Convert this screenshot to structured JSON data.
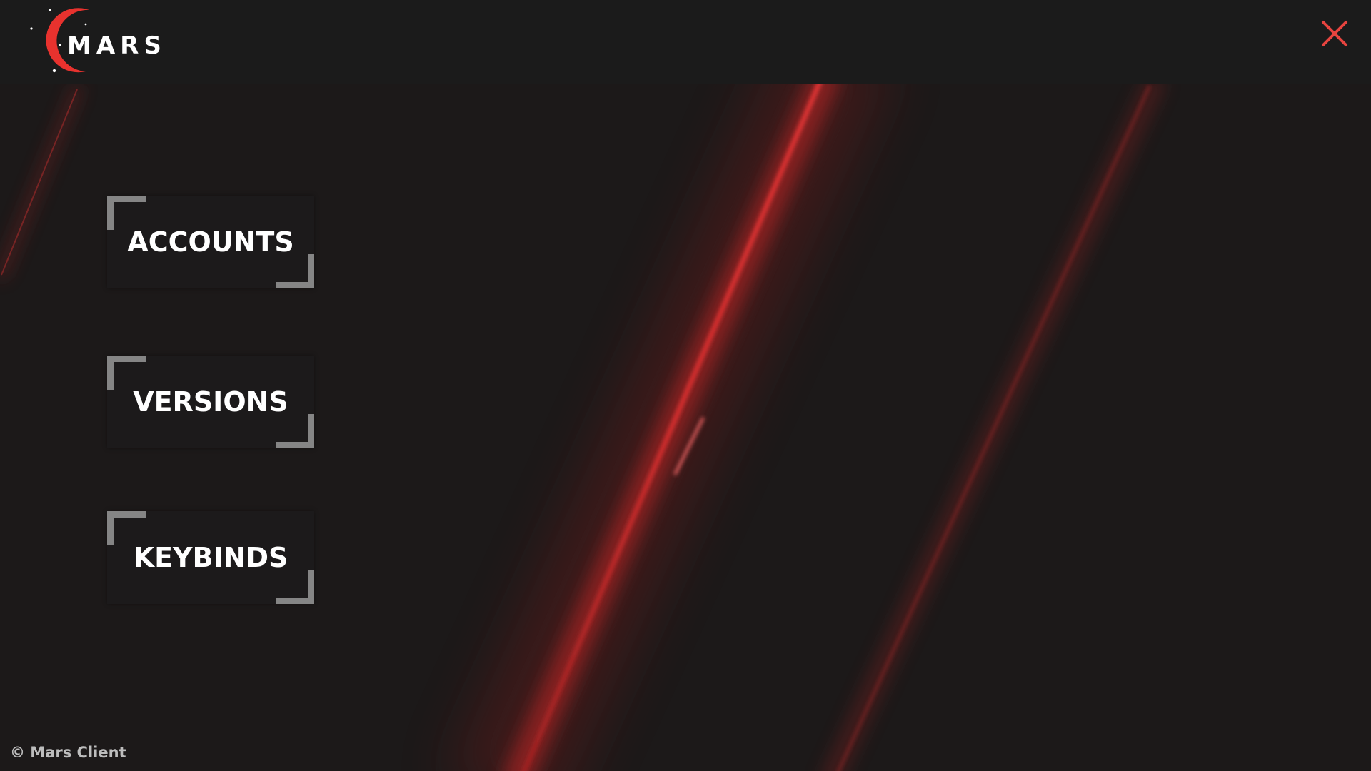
{
  "brand": {
    "name": "MARS",
    "logo_icon": "crescent-moon-icon",
    "accent_color": "#e8322e"
  },
  "window": {
    "close_icon": "close-icon",
    "close_color": "#e8443f"
  },
  "menu": {
    "items": [
      {
        "label": "ACCOUNTS"
      },
      {
        "label": "VERSIONS"
      },
      {
        "label": "KEYBINDS"
      }
    ]
  },
  "footer": {
    "copyright": "© Mars Client"
  }
}
